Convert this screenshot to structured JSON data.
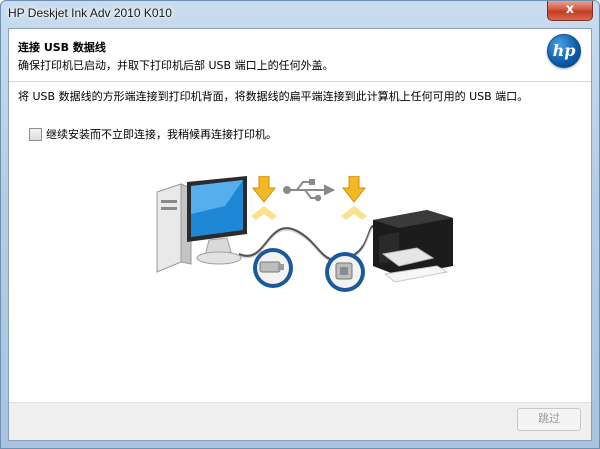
{
  "window": {
    "title": "HP Deskjet Ink Adv 2010 K010",
    "close_glyph": "x"
  },
  "header": {
    "heading": "连接 USB 数据线",
    "subheading": "确保打印机已启动，并取下打印机后部 USB 端口上的任何外盖。",
    "logo_text": "hp"
  },
  "main": {
    "instruction": "将 USB 数据线的方形端连接到打印机背面，将数据线的扁平端连接到此计算机上任何可用的 USB 端口。",
    "checkbox_label": "继续安装而不立即连接，我稍候再连接打印机。",
    "checkbox_checked": false
  },
  "footer": {
    "skip_label": "跳过",
    "skip_enabled": false
  },
  "icons": [
    "computer-icon",
    "printer-icon",
    "usb-symbol-icon",
    "arrow-down-icon",
    "usb-flat-connector-icon",
    "usb-square-connector-icon"
  ],
  "colors": {
    "arrow_yellow": "#f2b826",
    "monitor_blue": "#1e88d6",
    "logo_blue": "#0a5aa8"
  }
}
